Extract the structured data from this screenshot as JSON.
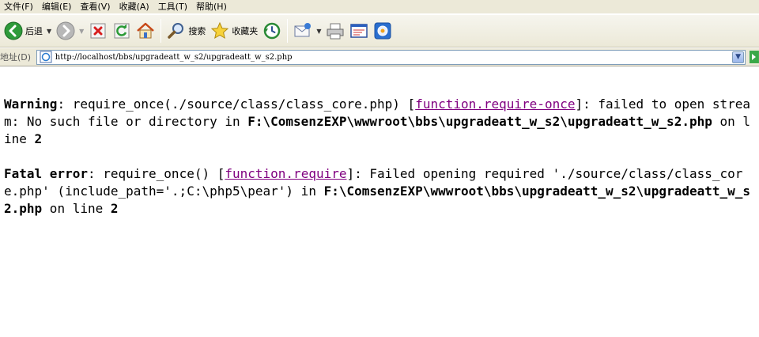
{
  "menu": {
    "items": [
      "文件(F)",
      "编辑(E)",
      "查看(V)",
      "收藏(A)",
      "工具(T)",
      "帮助(H)"
    ]
  },
  "toolbar": {
    "back_label": "后退",
    "search_label": "搜索",
    "favorites_label": "收藏夹"
  },
  "address": {
    "label": "地址(D)",
    "url": "http://localhost/bbs/upgradeatt_w_s2/upgradeatt_w_s2.php"
  },
  "errors": [
    {
      "level": "Warning",
      "pre": ": require_once(./source/class/class_core.php) [",
      "link": "function.require-once",
      "post": "]: failed to open stream: No such file or directory in ",
      "path": "F:\\ComsenzEXP\\wwwroot\\bbs\\upgradeatt_w_s2\\upgradeatt_w_s2.php",
      "on_line": " on line ",
      "line": "2"
    },
    {
      "level": "Fatal error",
      "pre": ": require_once() [",
      "link": "function.require",
      "post": "]: Failed opening required './source/class/class_core.php' (include_path='.;C:\\php5\\pear') in ",
      "path": "F:\\ComsenzEXP\\wwwroot\\bbs\\upgradeatt_w_s2\\upgradeatt_w_s2.php",
      "on_line": " on line ",
      "line": "2"
    }
  ]
}
